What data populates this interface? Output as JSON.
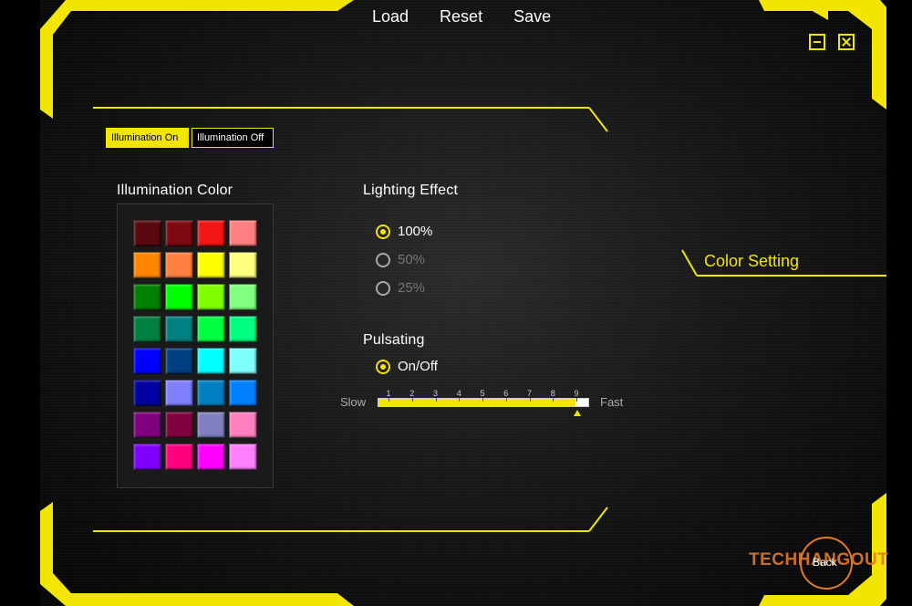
{
  "menu": {
    "load": "Load",
    "reset": "Reset",
    "save": "Save"
  },
  "illumination": {
    "on_label": "Illumination On",
    "off_label": "Illumination Off",
    "selected": "on"
  },
  "illumination_color": {
    "title": "Illumination Color",
    "swatches": [
      [
        "#5a0a0f",
        "#7d0a10",
        "#f21515",
        "#ff8080"
      ],
      [
        "#ff8400",
        "#ff8040",
        "#ffff00",
        "#ffff80"
      ],
      [
        "#008000",
        "#00ff00",
        "#80ff00",
        "#80ff80"
      ],
      [
        "#008040",
        "#008080",
        "#00ff40",
        "#00ff80"
      ],
      [
        "#0000ff",
        "#004080",
        "#00ffff",
        "#80ffff"
      ],
      [
        "#0000a0",
        "#8080ff",
        "#0080c0",
        "#0080ff"
      ],
      [
        "#800080",
        "#800040",
        "#8080c0",
        "#ff80c0"
      ],
      [
        "#8000ff",
        "#ff0080",
        "#ff00ff",
        "#ff80ff"
      ]
    ]
  },
  "lighting_effect": {
    "title": "Lighting Effect",
    "options": [
      {
        "label": "100%",
        "state": "selected"
      },
      {
        "label": "50%",
        "state": "disabled"
      },
      {
        "label": "25%",
        "state": "disabled"
      }
    ]
  },
  "pulsating": {
    "title": "Pulsating",
    "toggle_label": "On/Off",
    "enabled": true,
    "speed": {
      "slow_label": "Slow",
      "fast_label": "Fast",
      "ticks": [
        "1",
        "2",
        "3",
        "4",
        "5",
        "6",
        "7",
        "8",
        "9"
      ],
      "value": 9
    }
  },
  "side_tab": {
    "label": "Color Setting"
  },
  "back": {
    "label": "Back"
  },
  "watermark": {
    "text": "TECHHANGOUT"
  },
  "colors": {
    "accent": "#f2e600",
    "background": "#000000",
    "brand_orange": "#e07a28"
  }
}
